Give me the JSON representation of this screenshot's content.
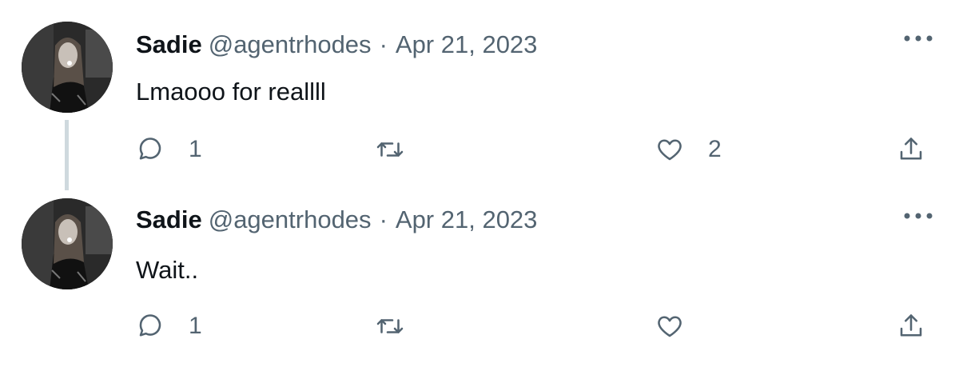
{
  "tweets": [
    {
      "display_name": "Sadie",
      "handle": "@agentrhodes",
      "separator": "·",
      "date": "Apr 21, 2023",
      "text": "Lmaooo for reallll",
      "reply_count": "1",
      "retweet_count": "",
      "like_count": "2"
    },
    {
      "display_name": "Sadie",
      "handle": "@agentrhodes",
      "separator": "·",
      "date": "Apr 21, 2023",
      "text": "Wait..",
      "reply_count": "1",
      "retweet_count": "",
      "like_count": ""
    }
  ],
  "icons": {
    "reply": "reply-icon",
    "retweet": "retweet-icon",
    "like": "heart-icon",
    "share": "share-icon",
    "more": "more-icon"
  },
  "colors": {
    "text_primary": "#0f1419",
    "text_secondary": "#536471",
    "thread_line": "#cfd9de",
    "background": "#ffffff"
  }
}
